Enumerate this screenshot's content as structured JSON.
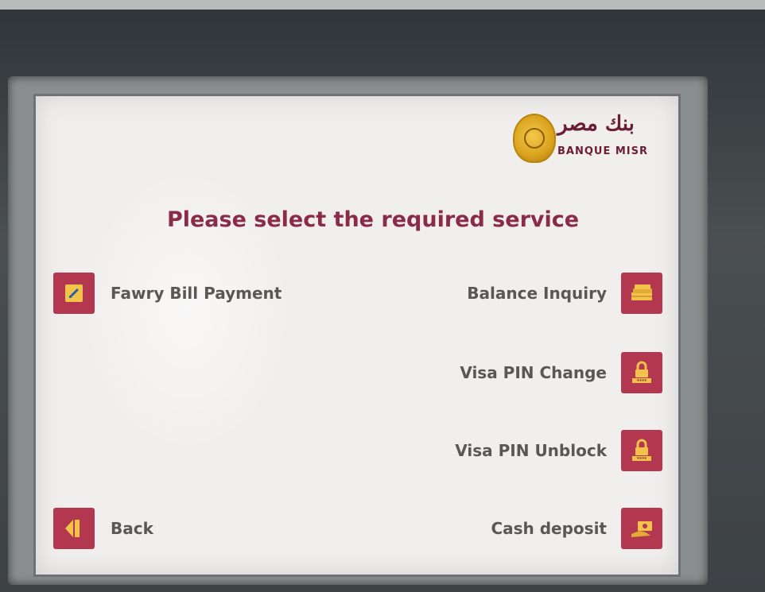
{
  "brand": {
    "name_ar": "بنك مصر",
    "name_en": "BANQUE MISR"
  },
  "screen": {
    "title": "Please select the required service"
  },
  "options": {
    "fawry": {
      "label": "Fawry Bill Payment",
      "icon": "bill-payment-icon"
    },
    "balance": {
      "label": "Balance Inquiry",
      "icon": "money-stack-icon"
    },
    "pin_change": {
      "label": "Visa PIN Change",
      "icon": "lock-pin-icon"
    },
    "pin_unblock": {
      "label": "Visa PIN Unblock",
      "icon": "lock-pin-icon"
    },
    "cash_deposit": {
      "label": "Cash deposit",
      "icon": "cash-deposit-icon"
    },
    "back": {
      "label": "Back",
      "icon": "back-arrow-icon"
    }
  },
  "colors": {
    "accent": "#b3384f",
    "title": "#8a2b47",
    "text": "#5b5657",
    "icon_fg": "#f2c24b"
  }
}
